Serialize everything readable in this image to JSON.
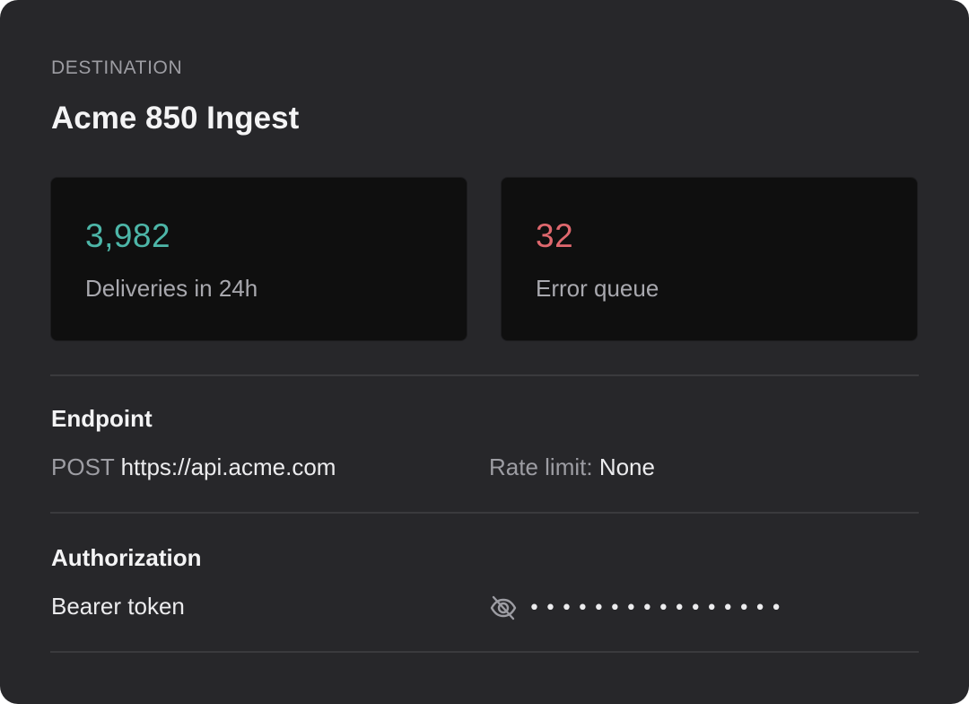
{
  "header": {
    "eyebrow": "DESTINATION",
    "title": "Acme 850 Ingest"
  },
  "stats": [
    {
      "value": "3,982",
      "label": "Deliveries in 24h",
      "color": "#4db6a8"
    },
    {
      "value": "32",
      "label": "Error queue",
      "color": "#e0686e"
    }
  ],
  "endpoint": {
    "title": "Endpoint",
    "method": "POST",
    "url": "https://api.acme.com",
    "rate_label": "Rate limit:",
    "rate_value": "None"
  },
  "authorization": {
    "title": "Authorization",
    "type": "Bearer token",
    "token_masked": "••••••••••••••••",
    "visibility_icon": "eye-off-icon"
  }
}
